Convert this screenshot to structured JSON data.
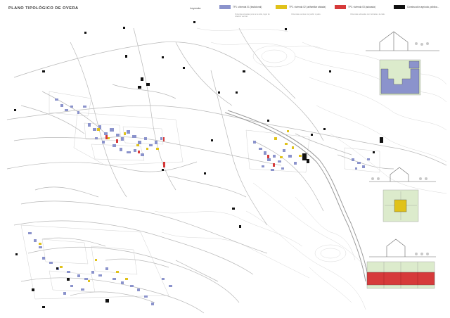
{
  "title": "PLANO TIPOLÓGICO DE OVERA",
  "legend": {
    "heading": "Leyenda",
    "items": [
      {
        "label": "TP1. vivienda 01 (tradicional)",
        "color": "#8b93cc"
      },
      {
        "label": "TP2. vivienda 02 (unifamiliar aislada)",
        "color": "#e0c21a"
      },
      {
        "label": "TP3. vivienda 03 (adosada)",
        "color": "#d63a3a"
      },
      {
        "label": "Construcción agrícola, pública...",
        "color": "#111111"
      }
    ],
    "notes": [
      "Viviendas situadas junto a la calle, lugar de relación vecinal.",
      "Viviendas exentas con jardín o patio.",
      "Viviendas adosadas con fachada a la calle."
    ]
  },
  "colors": {
    "road": "#bdbdbd",
    "contour": "#d6d6d6",
    "green": "#dcebcc"
  }
}
